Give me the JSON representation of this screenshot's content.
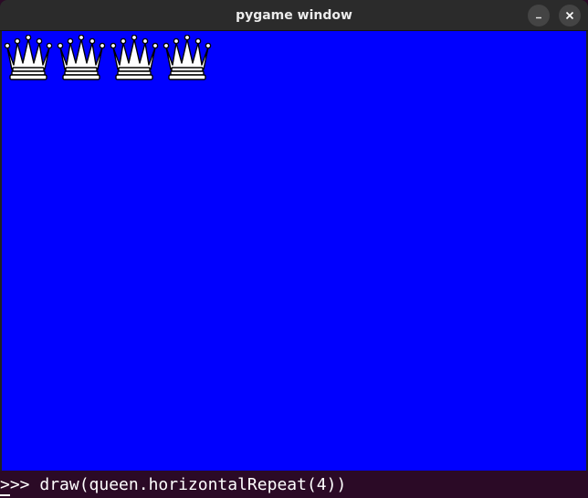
{
  "window": {
    "title": "pygame window",
    "minimize_icon": "minimize-icon",
    "close_icon": "close-icon",
    "canvas_color": "#0000ff"
  },
  "canvas": {
    "pieces": [
      {
        "piece": "queen",
        "color": "white",
        "icon": "chess-queen-icon"
      },
      {
        "piece": "queen",
        "color": "white",
        "icon": "chess-queen-icon"
      },
      {
        "piece": "queen",
        "color": "white",
        "icon": "chess-queen-icon"
      },
      {
        "piece": "queen",
        "color": "white",
        "icon": "chess-queen-icon"
      }
    ]
  },
  "terminal": {
    "prompt": ">>> ",
    "command": "draw(queen.horizontalRepeat(4))"
  }
}
